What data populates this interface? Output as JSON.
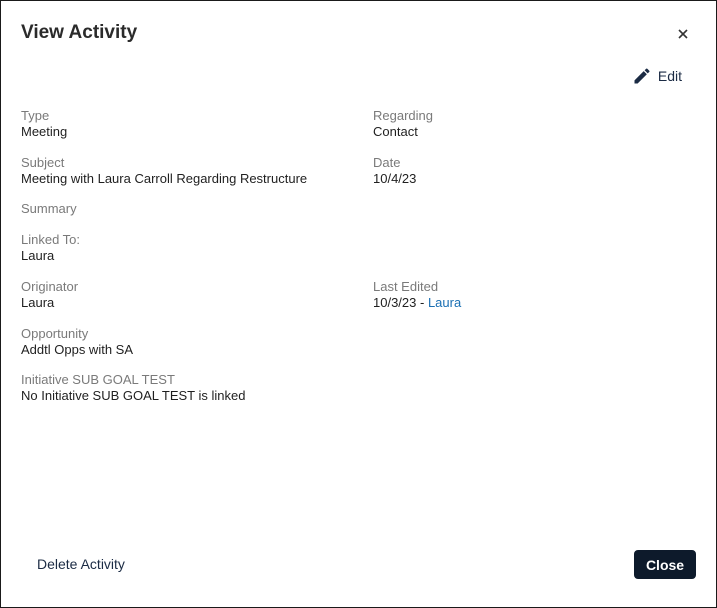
{
  "dialog": {
    "title": "View Activity",
    "edit_label": "Edit",
    "delete_label": "Delete Activity",
    "close_label": "Close"
  },
  "fields": {
    "type": {
      "label": "Type",
      "value": "Meeting"
    },
    "regarding": {
      "label": "Regarding",
      "value": "Contact"
    },
    "subject": {
      "label": "Subject",
      "value": "Meeting with Laura Carroll Regarding Restructure"
    },
    "date": {
      "label": "Date",
      "value": "10/4/23"
    },
    "summary": {
      "label": "Summary"
    },
    "linked_to": {
      "label": "Linked To:",
      "value": "Laura"
    },
    "originator": {
      "label": "Originator",
      "value": "Laura"
    },
    "last_edited": {
      "label": "Last Edited",
      "date": "10/3/23 - ",
      "user": "Laura"
    },
    "opportunity": {
      "label": "Opportunity",
      "value": "Addtl Opps with SA"
    },
    "initiative": {
      "label": "Initiative SUB GOAL TEST",
      "value": "No Initiative SUB GOAL TEST is linked"
    }
  },
  "colors": {
    "link": "#1a6fb3",
    "primary_button": "#0d1a2b",
    "label": "#7a7a7a"
  }
}
